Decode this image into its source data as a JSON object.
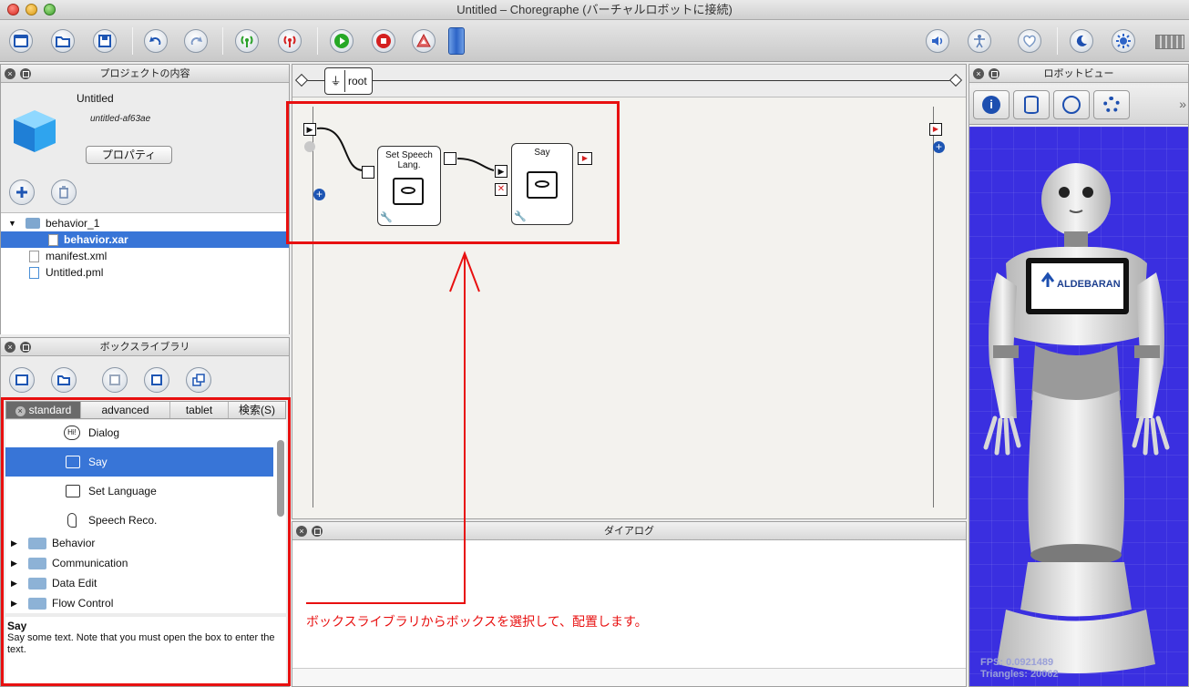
{
  "window": {
    "title": "Untitled – Choregraphe (バーチャルロボットに接続)"
  },
  "toolbar": {
    "icons": [
      "new-project-icon",
      "open-project-icon",
      "save-project-icon",
      "undo-icon",
      "redo-icon",
      "connect-icon",
      "disconnect-icon",
      "play-icon",
      "stop-icon",
      "debug-icon",
      "timeline-icon",
      "volume-icon",
      "wake-up-icon",
      "autonomous-life-icon",
      "rest-icon",
      "settings-icon",
      "battery-icon"
    ]
  },
  "project_panel": {
    "header": "プロジェクトの内容",
    "name": "Untitled",
    "id": "untitled-af63ae",
    "properties_label": "プロパティ",
    "tree": [
      {
        "label": "behavior_1",
        "type": "folder",
        "level": 0
      },
      {
        "label": "behavior.xar",
        "type": "file",
        "level": 1,
        "selected": true
      },
      {
        "label": "manifest.xml",
        "type": "file",
        "level": 0
      },
      {
        "label": "Untitled.pml",
        "type": "file",
        "level": 0
      }
    ]
  },
  "box_library": {
    "header": "ボックスライブラリ",
    "tabs": [
      "standard",
      "advanced",
      "tablet",
      "検索(S)"
    ],
    "active_tab": "standard",
    "items": [
      {
        "label": "Dialog"
      },
      {
        "label": "Say",
        "selected": true
      },
      {
        "label": "Set Language"
      },
      {
        "label": "Speech Reco."
      }
    ],
    "folders": [
      "Behavior",
      "Communication",
      "Data Edit",
      "Flow Control"
    ],
    "description_title": "Say",
    "description": "Say some text. Note that you must open the box to enter the text."
  },
  "flow": {
    "root_label": "root",
    "boxes": [
      {
        "title": "Set Speech Lang."
      },
      {
        "title": "Say"
      }
    ]
  },
  "dialog_panel": {
    "header": "ダイアログ"
  },
  "robot_view": {
    "header": "ロボットビュー",
    "tablet_brand": "ALDEBARAN",
    "fps": "FPS: 0.0921489",
    "triangles": "Triangles: 20062"
  },
  "annotation": {
    "text": "ボックスライブラリからボックスを選択して、配置します。",
    "color": "#e81010"
  }
}
